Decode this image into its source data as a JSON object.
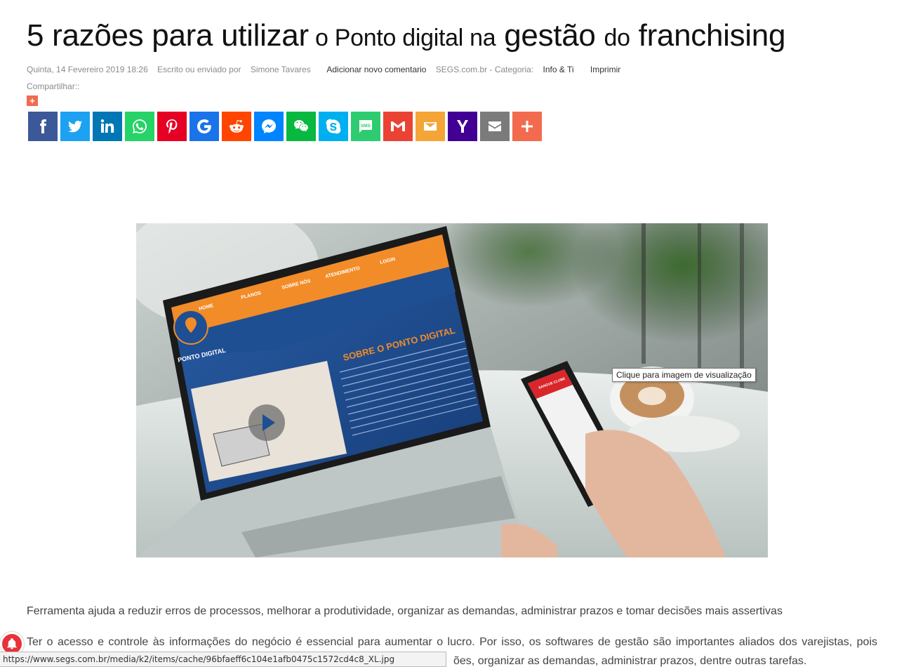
{
  "article": {
    "title_part1": "5 razões para utilizar",
    "title_part2": " o Ponto digital ",
    "title_part3": "na",
    "title_part4": " gestão ",
    "title_part5": "do",
    "title_part6": " franchising",
    "meta": {
      "date": "Quinta, 14 Fevereiro 2019 18:26",
      "author_label": "Escrito ou enviado por",
      "author": "Simone Tavares",
      "add_comment": "Adicionar novo comentario",
      "site_category_label": "SEGS.com.br - Categoria:",
      "category": "Info & Ti",
      "print": "Imprimir"
    },
    "share_label": "Compartilhar::",
    "hero_tooltip": "Clique para imagem de visualização",
    "lead": "Ferramenta ajuda a reduzir erros de processos, melhorar a produtividade, organizar as demandas, administrar prazos e tomar decisões mais assertivas",
    "para1": "Ter o acesso e controle às informações do negócio é essencial para aumentar o lucro. Por isso, os softwares de gestão são importantes aliados dos varejistas, pois",
    "para2": "ões, organizar as demandas, administrar prazos, dentre outras tarefas."
  },
  "hero_image": {
    "laptop_nav": [
      "HOME",
      "PLANOS",
      "SOBRE NÓS",
      "ATENDIMENTO",
      "LOGIN"
    ],
    "laptop_brand": "PONTO DIGITAL",
    "laptop_heading": "SOBRE O PONTO DIGITAL",
    "phone_header": "SANGUE CLUBE"
  },
  "social_buttons": [
    {
      "name": "facebook",
      "color": "#3b5998",
      "glyph": "f"
    },
    {
      "name": "twitter",
      "color": "#1da1f2",
      "glyph": ""
    },
    {
      "name": "linkedin",
      "color": "#0077b5",
      "glyph": "in"
    },
    {
      "name": "whatsapp",
      "color": "#25d366",
      "glyph": ""
    },
    {
      "name": "pinterest",
      "color": "#e60023",
      "glyph": "P"
    },
    {
      "name": "google",
      "color": "#1a73e8",
      "glyph": "G"
    },
    {
      "name": "reddit",
      "color": "#ff4500",
      "glyph": ""
    },
    {
      "name": "messenger",
      "color": "#0084ff",
      "glyph": ""
    },
    {
      "name": "wechat",
      "color": "#09b83e",
      "glyph": ""
    },
    {
      "name": "skype",
      "color": "#00aff0",
      "glyph": "S"
    },
    {
      "name": "sms",
      "color": "#2ecc71",
      "glyph": "SMS"
    },
    {
      "name": "gmail",
      "color": "#ea4335",
      "glyph": "M"
    },
    {
      "name": "email",
      "color": "#f4a536",
      "glyph": ""
    },
    {
      "name": "yahoo",
      "color": "#410093",
      "glyph": "Y"
    },
    {
      "name": "email-gray",
      "color": "#7b7b7b",
      "glyph": ""
    },
    {
      "name": "more",
      "color": "#f36b4f",
      "glyph": "+"
    }
  ],
  "status_url": "https://www.segs.com.br/media/k2/items/cache/96bfaeff6c104e1afb0475c1572cd4c8_XL.jpg"
}
